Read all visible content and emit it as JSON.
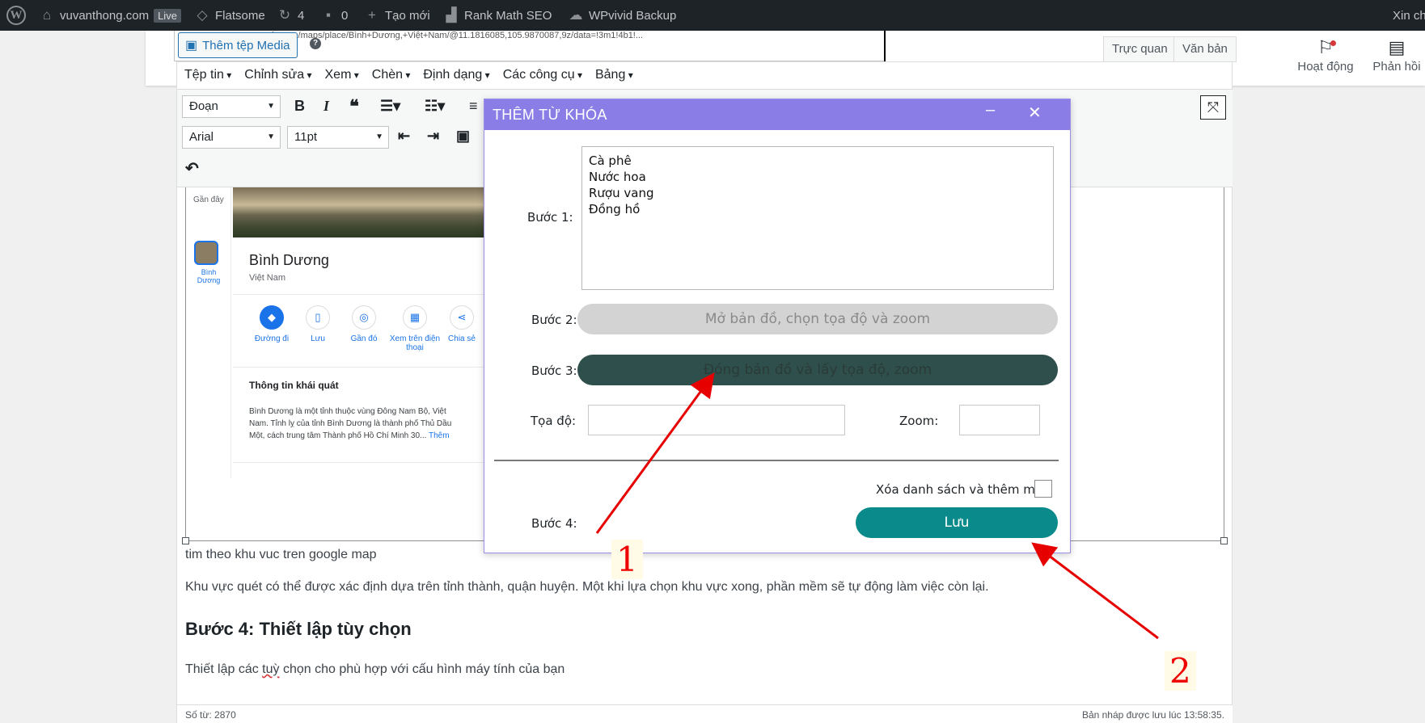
{
  "admin_bar": {
    "site_name": "vuvanthong.com",
    "live_badge": "Live",
    "theme": "Flatsome",
    "updates_count": "4",
    "comments_count": "0",
    "new_label": "Tạo mới",
    "seo_label": "Rank Math SEO",
    "backup_label": "WPvivid Backup",
    "greeting": "Xin ch"
  },
  "editor_header": {
    "add_media": "Thêm tệp Media",
    "help": "?",
    "address_bar": "gle.com/maps/place/Bình+Dương,+Việt+Nam/@11.1816085,105.9870087,9z/data=!3m1!4b1!...",
    "tab_visual": "Trực quan",
    "tab_text": "Văn bản",
    "activity_label": "Hoạt động",
    "feedback_label": "Phản hồi"
  },
  "menubar": [
    "Tệp tin",
    "Chỉnh sửa",
    "Xem",
    "Chèn",
    "Định dạng",
    "Các công cụ",
    "Bảng"
  ],
  "toolbar": {
    "block_format": "Đoạn",
    "font_family": "Arial",
    "font_size": "11pt"
  },
  "maps_screenshot": {
    "side_recent": "Gần đây",
    "side_place": "Bình Dương",
    "place_name": "Bình Dương",
    "country": "Việt Nam",
    "actions": [
      "Đường đi",
      "Lưu",
      "Gần đó",
      "Xem trên điện thoại",
      "Chia sẻ"
    ],
    "section_title": "Thông tin khái quát",
    "description_1": "Bình Dương là một tỉnh thuộc vùng Đông Nam Bộ, Việt",
    "description_2": "Nam. Tỉnh lỵ của tỉnh Bình Dương là thành phố Thủ Dầu",
    "description_3": "Một, cách trung tâm Thành phố Hồ Chí Minh 30...",
    "more_link": "Thêm"
  },
  "content": {
    "caption": "tim theo khu vuc tren google map",
    "paragraph_1": "Khu vực quét có thể được xác định dựa trên tỉnh thành, quận huyện. Một khi lựa chọn khu vực xong, phần mềm sẽ tự động làm việc còn lại.",
    "heading": "Bước 4: Thiết lập tùy chọn",
    "paragraph_2_a": "Thiết lập các ",
    "paragraph_2_b": "tuỳ",
    "paragraph_2_c": " chọn cho phù hợp với cấu hình máy tính của bạn"
  },
  "status": {
    "word_count": "Số từ: 2870",
    "draft_saved": "Bản nháp được lưu lúc 13:58:35."
  },
  "dialog": {
    "title": "THÊM TỪ KHÓA",
    "step1": "Bước 1:",
    "keywords": [
      "Cà phê",
      "Nước hoa",
      "Rượu vang",
      "Đồng hồ"
    ],
    "step2": "Bước 2:",
    "open_map_button": "Mở bản đồ, chọn tọa độ và zoom",
    "step3": "Bước 3:",
    "close_map_button": "Đóng bản đồ và lấy tọa độ, zoom",
    "coord_label": "Tọa độ:",
    "coord_value": "",
    "zoom_label": "Zoom:",
    "zoom_value": "",
    "clear_label": "Xóa danh sách và thêm mới",
    "step4": "Bước 4:",
    "save_button": "Lưu"
  },
  "annotations": {
    "label_1": "1",
    "label_2": "2",
    "arrow_color": "#e60000"
  }
}
